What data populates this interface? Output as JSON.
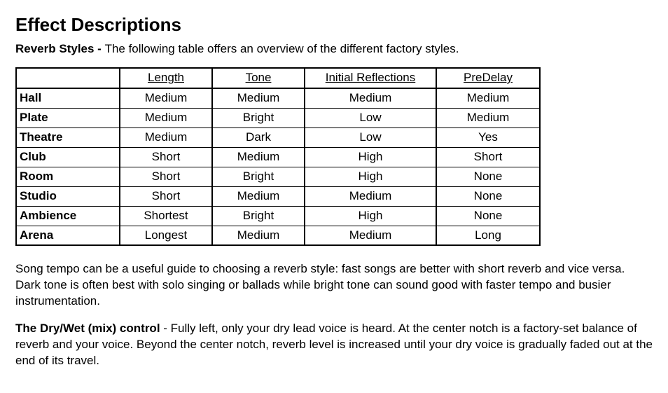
{
  "title": "Effect Descriptions",
  "intro": {
    "lead": "Reverb Styles - ",
    "text": "The following table offers an overview of the different factory styles."
  },
  "table": {
    "headers": {
      "style": "",
      "length": "Length",
      "tone": "Tone",
      "initial_reflections": "Initial Reflections",
      "predelay": "PreDelay"
    },
    "rows": [
      {
        "name": "Hall",
        "length": "Medium",
        "tone": "Medium",
        "ir": "Medium",
        "pd": "Medium"
      },
      {
        "name": "Plate",
        "length": "Medium",
        "tone": "Bright",
        "ir": "Low",
        "pd": "Medium"
      },
      {
        "name": "Theatre",
        "length": "Medium",
        "tone": "Dark",
        "ir": "Low",
        "pd": "Yes"
      },
      {
        "name": "Club",
        "length": "Short",
        "tone": "Medium",
        "ir": "High",
        "pd": "Short"
      },
      {
        "name": "Room",
        "length": "Short",
        "tone": "Bright",
        "ir": "High",
        "pd": "None"
      },
      {
        "name": "Studio",
        "length": "Short",
        "tone": "Medium",
        "ir": "Medium",
        "pd": "None"
      },
      {
        "name": "Ambience",
        "length": "Shortest",
        "tone": "Bright",
        "ir": "High",
        "pd": "None"
      },
      {
        "name": "Arena",
        "length": "Longest",
        "tone": "Medium",
        "ir": "Medium",
        "pd": "Long"
      }
    ]
  },
  "p1": "Song tempo can be a useful guide to choosing a reverb style: fast songs are better with short reverb and vice versa. Dark tone is often best with solo singing or ballads while bright tone can sound good with faster tempo and busier instrumentation.",
  "p2": {
    "lead": "The Dry/Wet (mix) control",
    "text": " - Fully left, only your dry lead voice is heard. At the center notch is a factory-set balance of reverb and your voice. Beyond the center notch, reverb level is increased until your dry voice is gradually faded out at the end of its travel."
  }
}
